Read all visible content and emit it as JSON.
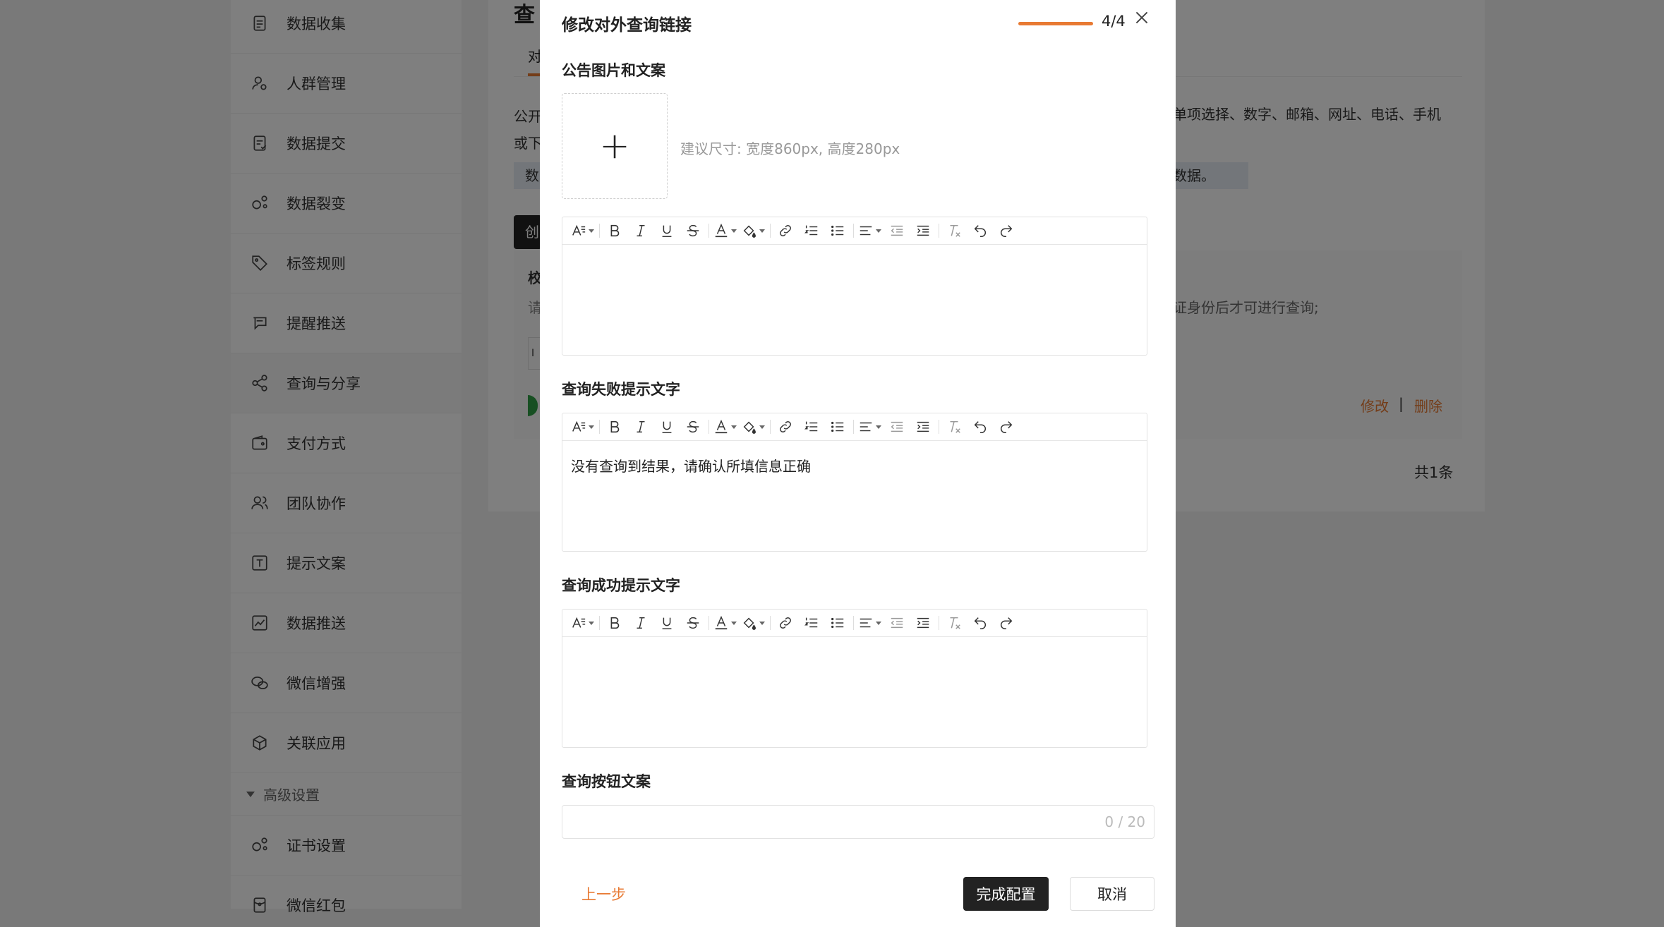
{
  "sidebar": {
    "items": [
      {
        "label": "数据收集",
        "icon": "document-icon"
      },
      {
        "label": "人群管理",
        "icon": "user-group-icon"
      },
      {
        "label": "数据提交",
        "icon": "submit-icon"
      },
      {
        "label": "数据裂变",
        "icon": "fission-icon"
      },
      {
        "label": "标签规则",
        "icon": "tag-icon"
      },
      {
        "label": "提醒推送",
        "icon": "remind-icon"
      },
      {
        "label": "查询与分享",
        "icon": "share-icon"
      },
      {
        "label": "支付方式",
        "icon": "wallet-icon"
      },
      {
        "label": "团队协作",
        "icon": "team-icon"
      },
      {
        "label": "提示文案",
        "icon": "text-icon"
      },
      {
        "label": "数据推送",
        "icon": "chart-icon"
      },
      {
        "label": "微信增强",
        "icon": "wechat-icon"
      },
      {
        "label": "关联应用",
        "icon": "cube-icon"
      }
    ],
    "group_label": "高级设置",
    "advanced_items": [
      {
        "label": "证书设置",
        "icon": "certificate-icon"
      },
      {
        "label": "微信红包",
        "icon": "red-packet-icon"
      }
    ]
  },
  "main": {
    "page_title": "查",
    "tab_label": "对",
    "desc_line1": "公开",
    "desc_line2": "或下",
    "desc_right": "单项选择、数字、邮箱、网址、电话、手机",
    "notice_left": "数",
    "notice_right": "数据。",
    "create_label": "创",
    "card_title": "校",
    "card_sub": "请",
    "card_hint": "证身份后才可进行查询;",
    "input_stub": "I",
    "edit_label": "修改",
    "separator": "|",
    "delete_label": "删除",
    "total": "共1条"
  },
  "modal": {
    "title": "修改对外查询链接",
    "step": "4/4",
    "progress": 1.0,
    "section_announcement": "公告图片和文案",
    "upload_hint": "建议尺寸: 宽度860px, 高度280px",
    "section_fail": "查询失败提示文字",
    "fail_text": "没有查询到结果，请确认所填信息正确",
    "section_success": "查询成功提示文字",
    "success_text": "",
    "section_button": "查询按钮文案",
    "button_text_value": "",
    "button_counter": "0 / 20",
    "prev_label": "上一步",
    "finish_label": "完成配置",
    "cancel_label": "取消"
  },
  "colors": {
    "accent": "#e87a33",
    "primary_button": "#222222",
    "overlay": "rgba(0,0,0,0.5)"
  }
}
